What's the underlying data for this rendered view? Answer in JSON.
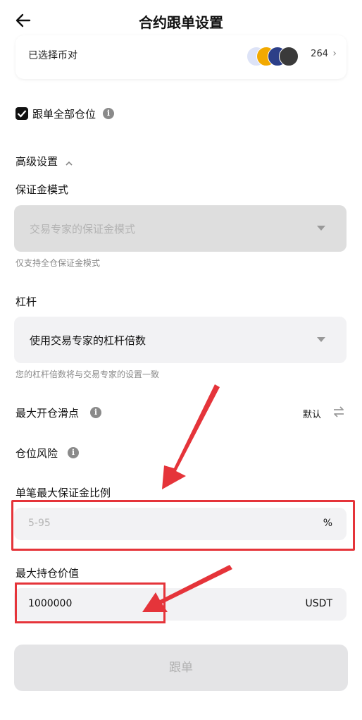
{
  "header": {
    "title": "合约跟单设置"
  },
  "pair": {
    "label": "已选择币对",
    "count": "264",
    "coin_colors": [
      "#dde3f7",
      "#f2a900",
      "#2c3f88",
      "#3a3a3a"
    ]
  },
  "copy_all": {
    "label": "跟单全部仓位",
    "checked": true
  },
  "advanced": {
    "label": "高级设置"
  },
  "margin_mode": {
    "label": "保证金模式",
    "value": "交易专家的保证金模式",
    "hint": "仅支持全仓保证金模式"
  },
  "leverage": {
    "label": "杠杆",
    "value": "使用交易专家的杠杆倍数",
    "hint": "您的杠杆倍数将与交易专家的设置一致"
  },
  "slippage": {
    "label": "最大开仓滑点",
    "value": "默认"
  },
  "risk": {
    "label": "仓位风险"
  },
  "max_margin_ratio": {
    "label": "单笔最大保证金比例",
    "placeholder": "5-95",
    "unit": "%"
  },
  "max_position": {
    "label": "最大持仓价值",
    "value": "1000000",
    "unit": "USDT"
  },
  "submit": {
    "label": "跟单"
  },
  "annotation_color": "#e5343a"
}
